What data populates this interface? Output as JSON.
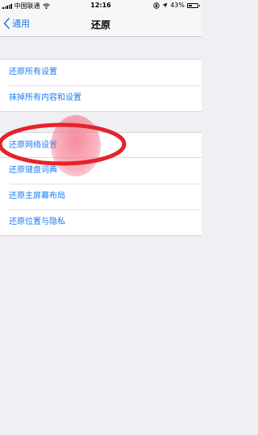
{
  "status_bar": {
    "carrier": "中国联通",
    "time": "12:16",
    "battery": "43%",
    "battery_level": 0.43
  },
  "nav": {
    "back_label": "通用",
    "title": "还原"
  },
  "group1": [
    "还原所有设置",
    "抹掉所有内容和设置"
  ],
  "group2": [
    "还原网络设置"
  ],
  "group3": [
    "还原键盘词典",
    "还原主屏幕布局",
    "还原位置与隐私"
  ],
  "colors": {
    "accent": "#1a7cf2",
    "annotation": "#e4232a",
    "background": "#efeff4"
  }
}
